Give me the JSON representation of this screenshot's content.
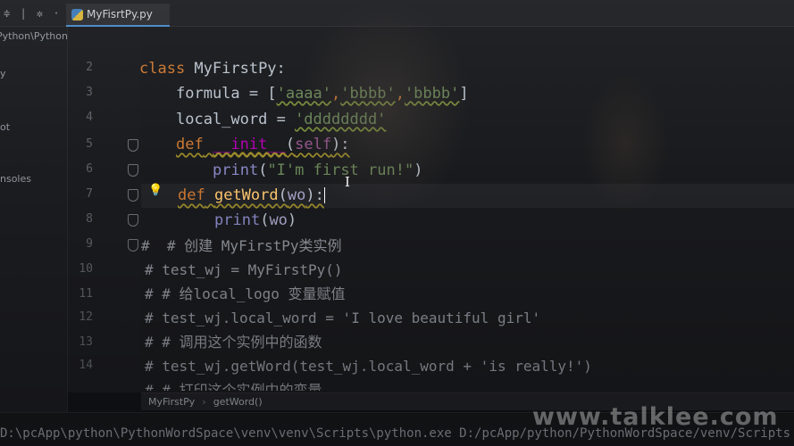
{
  "tab": {
    "file_name": "MyFisrtPy.py",
    "icon": "python-file-icon"
  },
  "toolbar": {
    "icons": "≑ | ✲ · |-"
  },
  "sidebar": {
    "items": [
      {
        "label": "Python\\Python"
      },
      {
        "label": "y"
      },
      {
        "label": "ot"
      },
      {
        "label": "nsoles"
      }
    ]
  },
  "editor": {
    "line_numbers": [
      "2",
      "3",
      "4",
      "5",
      "6",
      "7",
      "8",
      "9",
      "10",
      "11",
      "12",
      "13",
      "14"
    ],
    "lines": {
      "l2_kw": "class",
      "l2_rest": " MyFirstPy:",
      "l3_a": "formula = [",
      "l3_s1": "'aaaa'",
      "l3_c1": ",",
      "l3_s2": "'bbbb'",
      "l3_c2": ",",
      "l3_s3": "'bbbb'",
      "l3_b": "]",
      "l4_a": "local_word = ",
      "l4_s": "'dddddddd'",
      "l5_kw": "def",
      "l5_sp": " ",
      "l5_fn": "__init__",
      "l5_p1": "(",
      "l5_self": "self",
      "l5_p2": "):",
      "l6_fn": "print",
      "l6_p1": "(",
      "l6_s": "\"I'm first run!\"",
      "l6_p2": ")",
      "l7_kw": "def",
      "l7_sp": " ",
      "l7_fn": "getWord",
      "l7_p1": "(",
      "l7_param": "wo",
      "l7_p2": "):",
      "l8_fn": "print",
      "l8_p1": "(",
      "l8_param": "wo",
      "l8_p2": ")",
      "l9": "#  # 创建 MyFirstPy类实例",
      "l10": "# test_wj = MyFirstPy()",
      "l11": "# # 给local_logo 变量赋值",
      "l12": "# test_wj.local_word = 'I love beautiful girl'",
      "l13": "# # 调用这个实例中的函数",
      "l14": "# test_wj.getWord(test_wj.local_word + 'is really!')",
      "l15": "# # 打印这个实例中的变量"
    }
  },
  "breadcrumb": {
    "class_name": "MyFirstPy",
    "separator": "›",
    "method_name": "getWord()"
  },
  "console": {
    "command": "D:\\pcApp\\python\\PythonWordSpace\\venv\\venv\\Scripts\\python.exe D:/pcApp/python/PythonWordSpace/venv/Scripts"
  },
  "watermark": {
    "text": "www.talklee.com"
  },
  "colors": {
    "keyword": "#cc7832",
    "string": "#6a8759",
    "function": "#ffc66d",
    "self": "#94558d",
    "accent": "#4a88c7"
  }
}
